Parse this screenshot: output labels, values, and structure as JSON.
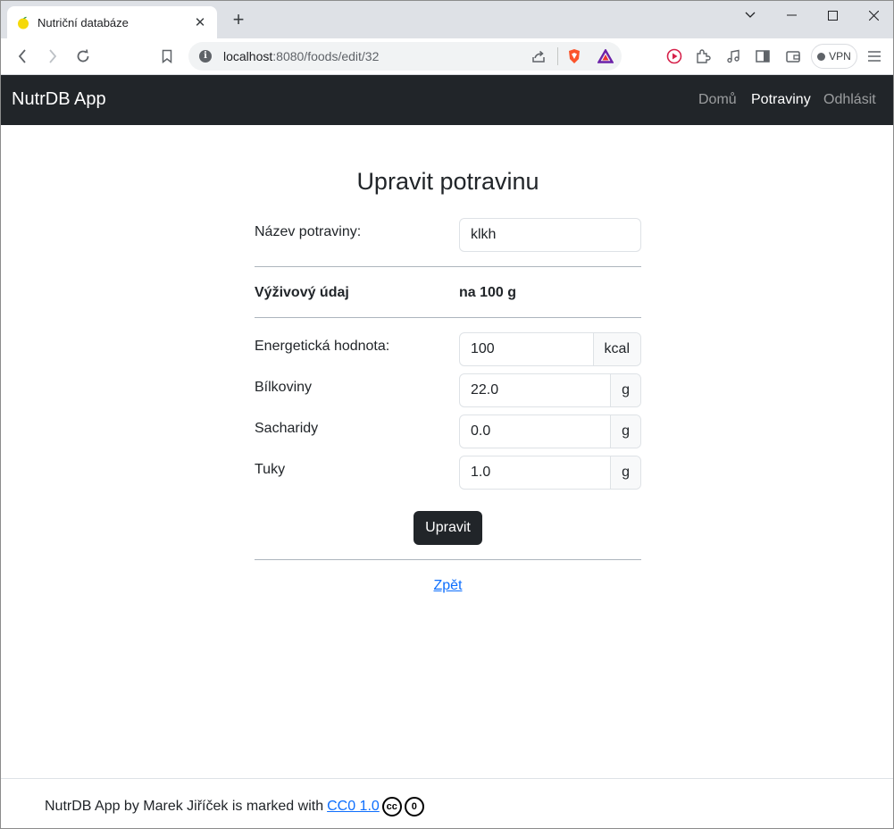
{
  "browser": {
    "tab_title": "Nutriční databáze",
    "url_host": "localhost",
    "url_path": ":8080/foods/edit/32",
    "vpn_label": "VPN"
  },
  "navbar": {
    "brand": "NutrDB App",
    "links": [
      "Domů",
      "Potraviny",
      "Odhlásit"
    ],
    "active_index": 1
  },
  "form": {
    "title": "Upravit potravinu",
    "name_label": "Název potraviny:",
    "name_value": "klkh",
    "header_left": "Výživový údaj",
    "header_right": "na 100 g",
    "nutrients": [
      {
        "label": "Energetická hodnota:",
        "value": "100",
        "unit": "kcal"
      },
      {
        "label": "Bílkoviny",
        "value": "22.0",
        "unit": "g"
      },
      {
        "label": "Sacharidy",
        "value": "0.0",
        "unit": "g"
      },
      {
        "label": "Tuky",
        "value": "1.0",
        "unit": "g"
      }
    ],
    "submit_label": "Upravit",
    "back_label": "Zpět"
  },
  "footer": {
    "text": "NutrDB App by Marek Jiříček is marked with",
    "license": "CC0 1.0",
    "cc_icon": "cc",
    "zero_icon": "0"
  }
}
